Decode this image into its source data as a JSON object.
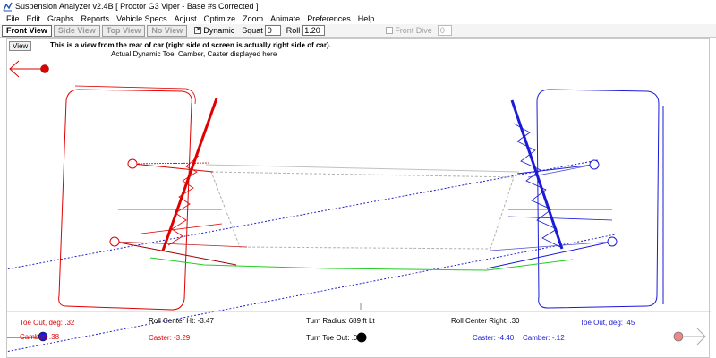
{
  "window": {
    "title": "Suspension Analyzer v2.4B   [ Proctor G3 Viper - Base #s Corrected ]"
  },
  "menu": [
    "File",
    "Edit",
    "Graphs",
    "Reports",
    "Vehicle Specs",
    "Adjust",
    "Optimize",
    "Zoom",
    "Animate",
    "Preferences",
    "Help"
  ],
  "toolbar": {
    "tabs": [
      "Front View",
      "Side View",
      "Top View",
      "No View"
    ],
    "dynamic_label": "Dynamic",
    "dynamic_checked": true,
    "squat_label": "Squat",
    "squat_value": "0",
    "roll_label": "Roll",
    "roll_value": "1.20",
    "front_dive_label": "Front Dive",
    "front_dive_value": "0"
  },
  "view": {
    "button": "View",
    "note_main": "This is a view from the rear of car (right side of screen is actually right side of car).",
    "note_sub": "Actual Dynamic Toe, Camber, Caster displayed here"
  },
  "readouts": {
    "toe_left": "Toe Out, deg: .32",
    "camber_left": "Camber: .38",
    "roll_center_ht": "Roll Center Ht: -3.47",
    "caster_left": "Caster: -3.29",
    "turn_radius": "Turn Radius: 689 ft Lt",
    "turn_toe_out": "Turn Toe Out: .007",
    "roll_center_right": "Roll Center Right: .30",
    "toe_right": "Toe Out, deg: .45",
    "caster_right": "Caster: -4.40",
    "camber_right": "Camber: -.12"
  },
  "colors": {
    "left": "#e00000",
    "right": "#1a1ad8",
    "roll_line": "#22cc22",
    "chassis": "#b0b0b0",
    "crosshair": "#2222cc"
  },
  "icons": {
    "nav_left": "left-arrow-icon",
    "nav_right": "right-arrow-icon"
  }
}
